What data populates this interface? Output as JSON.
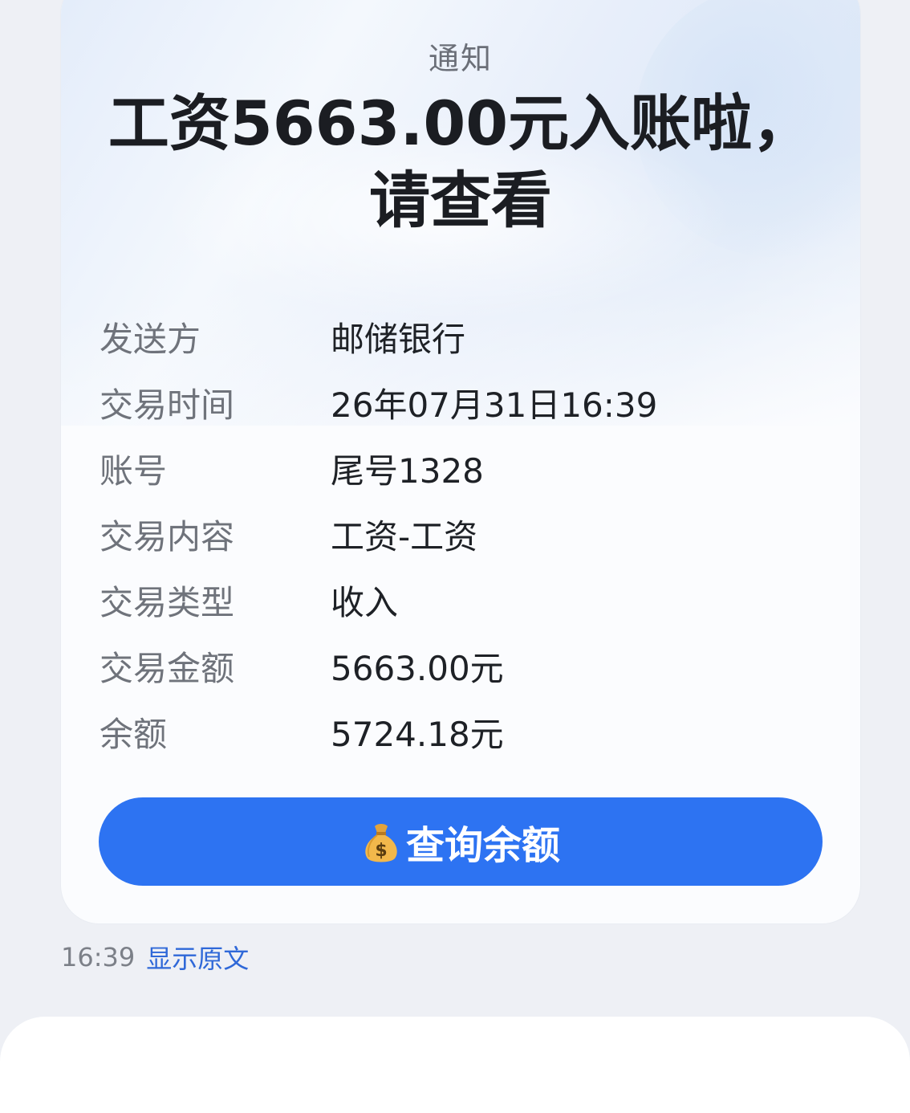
{
  "card": {
    "label": "通知",
    "headline": "工资5663.00元入账啦，请查看",
    "rows": [
      {
        "label": "发送方",
        "value": "邮储银行"
      },
      {
        "label": "交易时间",
        "value": "26年07月31日16:39"
      },
      {
        "label": "账号",
        "value": "尾号1328"
      },
      {
        "label": "交易内容",
        "value": "工资-工资"
      },
      {
        "label": "交易类型",
        "value": "收入"
      },
      {
        "label": "交易金额",
        "value": "5663.00元"
      },
      {
        "label": "余额",
        "value": "5724.18元"
      }
    ],
    "button_label": "查询余额",
    "button_icon": "money-bag-icon"
  },
  "meta": {
    "time": "16:39",
    "show_original": "显示原文"
  },
  "colors": {
    "accent": "#2d73f2",
    "link": "#2f68d8",
    "background": "#eef0f5"
  }
}
